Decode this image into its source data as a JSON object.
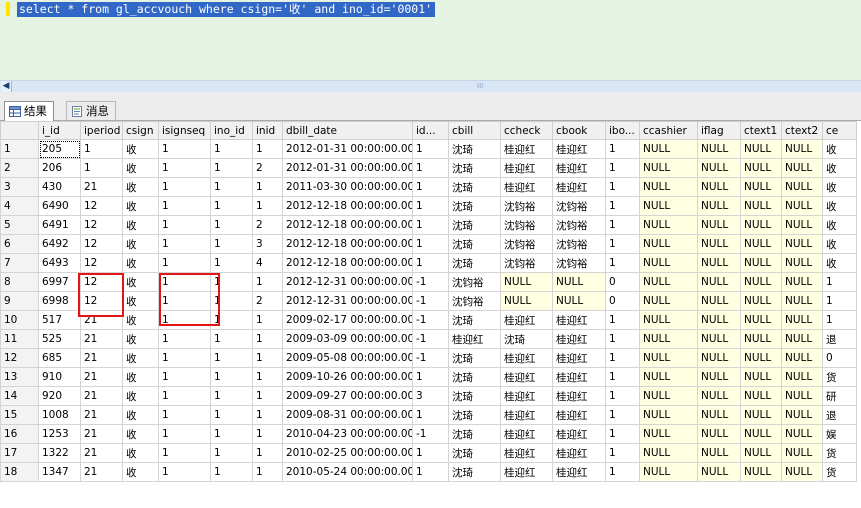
{
  "editor": {
    "sql": "select * from gl_accvouch where csign='收' and ino_id='0001'"
  },
  "tabs": [
    {
      "label": "结果"
    },
    {
      "label": "消息"
    }
  ],
  "columns": [
    "i_id",
    "iperiod",
    "csign",
    "isignseq",
    "ino_id",
    "inid",
    "dbill_date",
    "id...",
    "cbill",
    "ccheck",
    "cbook",
    "ibo...",
    "ccashier",
    "iflag",
    "ctext1",
    "ctext2",
    "ce"
  ],
  "rows": [
    [
      "1",
      "205",
      "1",
      "收",
      "1",
      "1",
      "1",
      "2012-01-31 00:00:00.000",
      "1",
      "沈琦",
      "桂迎红",
      "桂迎红",
      "1",
      "NULL",
      "NULL",
      "NULL",
      "NULL",
      "收"
    ],
    [
      "2",
      "206",
      "1",
      "收",
      "1",
      "1",
      "2",
      "2012-01-31 00:00:00.000",
      "1",
      "沈琦",
      "桂迎红",
      "桂迎红",
      "1",
      "NULL",
      "NULL",
      "NULL",
      "NULL",
      "收"
    ],
    [
      "3",
      "430",
      "21",
      "收",
      "1",
      "1",
      "1",
      "2011-03-30 00:00:00.000",
      "1",
      "沈琦",
      "桂迎红",
      "桂迎红",
      "1",
      "NULL",
      "NULL",
      "NULL",
      "NULL",
      "收"
    ],
    [
      "4",
      "6490",
      "12",
      "收",
      "1",
      "1",
      "1",
      "2012-12-18 00:00:00.000",
      "1",
      "沈琦",
      "沈钧裕",
      "沈钧裕",
      "1",
      "NULL",
      "NULL",
      "NULL",
      "NULL",
      "收"
    ],
    [
      "5",
      "6491",
      "12",
      "收",
      "1",
      "1",
      "2",
      "2012-12-18 00:00:00.000",
      "1",
      "沈琦",
      "沈钧裕",
      "沈钧裕",
      "1",
      "NULL",
      "NULL",
      "NULL",
      "NULL",
      "收"
    ],
    [
      "6",
      "6492",
      "12",
      "收",
      "1",
      "1",
      "3",
      "2012-12-18 00:00:00.000",
      "1",
      "沈琦",
      "沈钧裕",
      "沈钧裕",
      "1",
      "NULL",
      "NULL",
      "NULL",
      "NULL",
      "收"
    ],
    [
      "7",
      "6493",
      "12",
      "收",
      "1",
      "1",
      "4",
      "2012-12-18 00:00:00.000",
      "1",
      "沈琦",
      "沈钧裕",
      "沈钧裕",
      "1",
      "NULL",
      "NULL",
      "NULL",
      "NULL",
      "收"
    ],
    [
      "8",
      "6997",
      "12",
      "收",
      "1",
      "1",
      "1",
      "2012-12-31 00:00:00.000",
      "-1",
      "沈钧裕",
      "NULL",
      "NULL",
      "0",
      "NULL",
      "NULL",
      "NULL",
      "NULL",
      "1"
    ],
    [
      "9",
      "6998",
      "12",
      "收",
      "1",
      "1",
      "2",
      "2012-12-31 00:00:00.000",
      "-1",
      "沈钧裕",
      "NULL",
      "NULL",
      "0",
      "NULL",
      "NULL",
      "NULL",
      "NULL",
      "1"
    ],
    [
      "10",
      "517",
      "21",
      "收",
      "1",
      "1",
      "1",
      "2009-02-17 00:00:00.000",
      "-1",
      "沈琦",
      "桂迎红",
      "桂迎红",
      "1",
      "NULL",
      "NULL",
      "NULL",
      "NULL",
      "1"
    ],
    [
      "11",
      "525",
      "21",
      "收",
      "1",
      "1",
      "1",
      "2009-03-09 00:00:00.000",
      "-1",
      "桂迎红",
      "沈琦",
      "桂迎红",
      "1",
      "NULL",
      "NULL",
      "NULL",
      "NULL",
      "退"
    ],
    [
      "12",
      "685",
      "21",
      "收",
      "1",
      "1",
      "1",
      "2009-05-08 00:00:00.000",
      "-1",
      "沈琦",
      "桂迎红",
      "桂迎红",
      "1",
      "NULL",
      "NULL",
      "NULL",
      "NULL",
      "0"
    ],
    [
      "13",
      "910",
      "21",
      "收",
      "1",
      "1",
      "1",
      "2009-10-26 00:00:00.000",
      "1",
      "沈琦",
      "桂迎红",
      "桂迎红",
      "1",
      "NULL",
      "NULL",
      "NULL",
      "NULL",
      "货"
    ],
    [
      "14",
      "920",
      "21",
      "收",
      "1",
      "1",
      "1",
      "2009-09-27 00:00:00.000",
      "3",
      "沈琦",
      "桂迎红",
      "桂迎红",
      "1",
      "NULL",
      "NULL",
      "NULL",
      "NULL",
      "研"
    ],
    [
      "15",
      "1008",
      "21",
      "收",
      "1",
      "1",
      "1",
      "2009-08-31 00:00:00.000",
      "1",
      "沈琦",
      "桂迎红",
      "桂迎红",
      "1",
      "NULL",
      "NULL",
      "NULL",
      "NULL",
      "退"
    ],
    [
      "16",
      "1253",
      "21",
      "收",
      "1",
      "1",
      "1",
      "2010-04-23 00:00:00.000",
      "-1",
      "沈琦",
      "桂迎红",
      "桂迎红",
      "1",
      "NULL",
      "NULL",
      "NULL",
      "NULL",
      "娱"
    ],
    [
      "17",
      "1322",
      "21",
      "收",
      "1",
      "1",
      "1",
      "2010-02-25 00:00:00.000",
      "1",
      "沈琦",
      "桂迎红",
      "桂迎红",
      "1",
      "NULL",
      "NULL",
      "NULL",
      "NULL",
      "货"
    ],
    [
      "18",
      "1347",
      "21",
      "收",
      "1",
      "1",
      "1",
      "2010-05-24 00:00:00.000",
      "1",
      "沈琦",
      "桂迎红",
      "桂迎红",
      "1",
      "NULL",
      "NULL",
      "NULL",
      "NULL",
      "货"
    ]
  ],
  "colors": {
    "selection": "#3168c8",
    "editor_bg": "#e5f3e2",
    "null_bg": "#ffffe1",
    "highlight": "#e21616"
  }
}
